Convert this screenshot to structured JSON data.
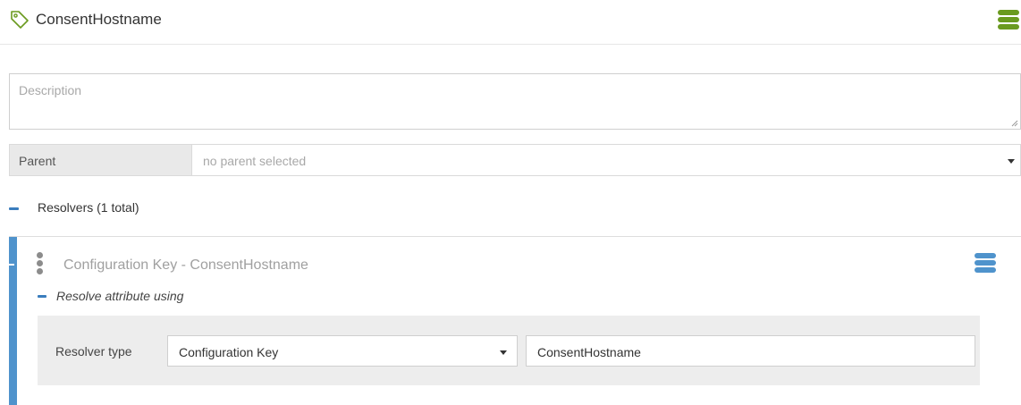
{
  "header": {
    "title": "ConsentHostname",
    "tag_icon": "tag-icon",
    "menu_icon": "hamburger-menu-icon",
    "accent_green": "#6a9a1f"
  },
  "description": {
    "placeholder": "Description",
    "value": ""
  },
  "parent": {
    "label": "Parent",
    "selected": "no parent selected"
  },
  "resolvers": {
    "title": "Resolvers (1 total)",
    "accent_blue": "#4f93cc",
    "items": [
      {
        "name": "Configuration Key - ConsentHostname",
        "section_label": "Resolve attribute using",
        "type_label": "Resolver type",
        "type_value": "Configuration Key",
        "value": "ConsentHostname"
      }
    ]
  }
}
